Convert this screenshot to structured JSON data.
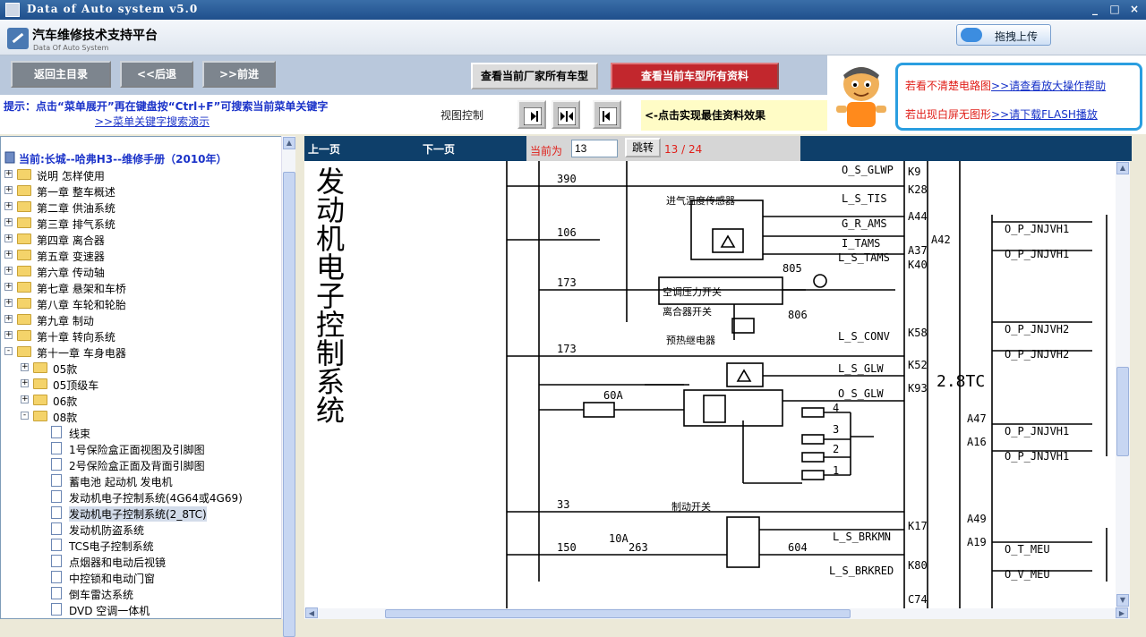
{
  "window": {
    "title": "Data of Auto system v5.0",
    "controls": [
      "_",
      "□",
      "×"
    ]
  },
  "header": {
    "app_name": "汽车维修技术支持平台",
    "app_sub": "Data Of Auto System",
    "upload_label": "拖拽上传"
  },
  "toolbar": {
    "home": "返回主目录",
    "back": "<<后退",
    "forward": ">>前进",
    "all_models": "查看当前厂家所有车型",
    "all_data": "查看当前车型所有资料"
  },
  "tips": {
    "line1": "提示：点击“菜单展开”再在键盘按“Ctrl+F”可搜索当前菜单关键字",
    "line2": ">>菜单关键字搜索演示",
    "view_label": "视图控制",
    "best": "<-点击实现最佳资料效果"
  },
  "helper": {
    "line1_text": "若看不清楚电路图",
    "line1_link": ">>请查看放大操作帮助",
    "line2_text": "若出现白屏无图形",
    "line2_link": ">>请下载FLASH播放"
  },
  "tree": {
    "current": "当前:长城--哈弗H3--维修手册（2010年）",
    "items": [
      {
        "label": "说明 怎样使用",
        "type": "folder",
        "exp": "+"
      },
      {
        "label": "第一章  整车概述",
        "type": "folder",
        "exp": "+"
      },
      {
        "label": "第二章  供油系统",
        "type": "folder",
        "exp": "+"
      },
      {
        "label": "第三章  排气系统",
        "type": "folder",
        "exp": "+"
      },
      {
        "label": "第四章  离合器",
        "type": "folder",
        "exp": "+"
      },
      {
        "label": "第五章  变速器",
        "type": "folder",
        "exp": "+"
      },
      {
        "label": "第六章  传动轴",
        "type": "folder",
        "exp": "+"
      },
      {
        "label": "第七章  悬架和车桥",
        "type": "folder",
        "exp": "+"
      },
      {
        "label": "第八章  车轮和轮胎",
        "type": "folder",
        "exp": "+"
      },
      {
        "label": "第九章  制动",
        "type": "folder",
        "exp": "+"
      },
      {
        "label": "第十章  转向系统",
        "type": "folder",
        "exp": "+"
      },
      {
        "label": "第十一章  车身电器",
        "type": "folder",
        "exp": "-"
      },
      {
        "label": "05款",
        "type": "folder",
        "exp": "+"
      },
      {
        "label": "05顶级车",
        "type": "folder",
        "exp": "+"
      },
      {
        "label": "06款",
        "type": "folder",
        "exp": "+"
      },
      {
        "label": "08款",
        "type": "folder",
        "exp": "-"
      },
      {
        "label": "线束",
        "type": "doc"
      },
      {
        "label": "1号保险盒正面视图及引脚图",
        "type": "doc"
      },
      {
        "label": "2号保险盒正面及背面引脚图",
        "type": "doc"
      },
      {
        "label": "蓄电池  起动机  发电机",
        "type": "doc"
      },
      {
        "label": "发动机电子控制系统(4G64或4G69)",
        "type": "doc"
      },
      {
        "label": "发动机电子控制系统(2_8TC)",
        "type": "doc",
        "selected": true
      },
      {
        "label": "发动机防盗系统",
        "type": "doc"
      },
      {
        "label": "TCS电子控制系统",
        "type": "doc"
      },
      {
        "label": "点烟器和电动后视镜",
        "type": "doc"
      },
      {
        "label": "中控锁和电动门窗",
        "type": "doc"
      },
      {
        "label": "倒车雷达系统",
        "type": "doc"
      },
      {
        "label": "DVD 空调一体机",
        "type": "doc"
      }
    ]
  },
  "pager": {
    "prev": "上一页",
    "next": "下一页",
    "current_label": "当前为",
    "current_value": "13",
    "jump": "跳转",
    "count": "13 / 24"
  },
  "document": {
    "title": "发动机电子控制系统",
    "wires": [
      "390",
      "106",
      "173",
      "173",
      "60A",
      "33",
      "150",
      "10A",
      "263",
      "604",
      "805",
      "806"
    ],
    "pins": [
      "K9",
      "K28",
      "A44",
      "A42",
      "K40",
      "A37",
      "K58",
      "K52",
      "K93",
      "K17",
      "K80",
      "C74",
      "A16",
      "A47",
      "A19",
      "A49"
    ],
    "signals": [
      "O_S_GLWP",
      "L_S_TIS",
      "G_R_AMS",
      "I_TAMS",
      "L_S_TAMS",
      "L_S_CONV",
      "L_S_GLW",
      "O_S_GLW",
      "L_S_BRKMN",
      "L_S_BRKRED"
    ],
    "right_signals": [
      "O_P_JNJVH1",
      "O_P_JNJVH1",
      "O_P_JNJVH2",
      "O_P_JNJVH2",
      "O_P_JNJVH1",
      "O_P_JNJVH1",
      "O_T_MEU",
      "O_V_MEU"
    ],
    "block_label": "2.8TC",
    "relay_labels": [
      "进气温度传感器",
      "空调压力开关",
      "离合器开关",
      "预热继电器",
      "制动开关"
    ],
    "connector_nums": [
      "1",
      "2",
      "3",
      "4"
    ]
  }
}
